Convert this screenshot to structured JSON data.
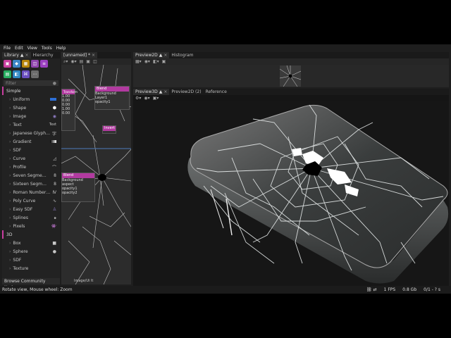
{
  "menu": [
    "File",
    "Edit",
    "View",
    "Tools",
    "Help"
  ],
  "library": {
    "tabs": [
      "Library",
      "Hierarchy"
    ],
    "filter_placeholder": "Filter",
    "icon_colors": [
      "#c93ea0",
      "#6aa84f",
      "#d4a017",
      "#4aa3c9",
      "#8e44ad",
      "#9b59b6",
      "#27ae60",
      "#3c78d8",
      "#16a085",
      "#8e7cc3"
    ],
    "sections": [
      {
        "name": "Simple",
        "items": [
          {
            "label": "Uniform",
            "thumb": "bar-blue"
          },
          {
            "label": "Shape",
            "thumb": "hexagon"
          },
          {
            "label": "Image",
            "thumb": "image-circle"
          },
          {
            "label": "Text",
            "thumb": "text",
            "thumb_text": "Text"
          },
          {
            "label": "Japanese Glyph…",
            "thumb": "glyph"
          },
          {
            "label": "Gradient",
            "thumb": "gradient"
          },
          {
            "label": "SDF",
            "thumb": "none"
          },
          {
            "label": "Curve",
            "thumb": "curve"
          },
          {
            "label": "Profile",
            "thumb": "profile"
          },
          {
            "label": "Seven Segme…",
            "thumb": "segment"
          },
          {
            "label": "Sixteen Segm…",
            "thumb": "segment"
          },
          {
            "label": "Roman Number…",
            "thumb": "roman"
          },
          {
            "label": "Poly Curve",
            "thumb": "poly"
          },
          {
            "label": "Easy SDF",
            "thumb": "easy-sdf"
          },
          {
            "label": "Splines",
            "thumb": "spiral"
          },
          {
            "label": "Pixels",
            "thumb": "invader"
          }
        ]
      },
      {
        "name": "3D",
        "items": [
          {
            "label": "Box",
            "thumb": "box"
          },
          {
            "label": "Sphere",
            "thumb": "sphere"
          },
          {
            "label": "SDF",
            "thumb": "none"
          },
          {
            "label": "Texture",
            "thumb": "none"
          }
        ]
      }
    ],
    "browse": "Browse Community Nodes"
  },
  "graph": {
    "tab": "[unnamed] *",
    "nodes": [
      {
        "title": "Blend",
        "rows": [
          "Background",
          "Layer1",
          "opacity1"
        ]
      },
      {
        "title": "Invert",
        "rows": []
      },
      {
        "title": "Blend",
        "rows": [
          "Background",
          "aspect",
          "opacity1",
          "opacity2"
        ]
      },
      {
        "title": "Transform",
        "rows": [
          "1.00",
          "0.00",
          "0.00",
          "1.00",
          "0.00",
          "0.00"
        ]
      }
    ],
    "bottom_label": "Image/Ui lt"
  },
  "preview2d": {
    "tabs": [
      "Preview2D",
      "Histogram"
    ]
  },
  "preview3d": {
    "tabs": [
      "Preview3D",
      "Preview2D (2)",
      "Reference"
    ]
  },
  "status": {
    "hint": "Rotate view, Mouse wheel: Zoom",
    "fps": "1 FPS",
    "mem": "0.8 Gb",
    "progress": "0/1 - ? s"
  }
}
